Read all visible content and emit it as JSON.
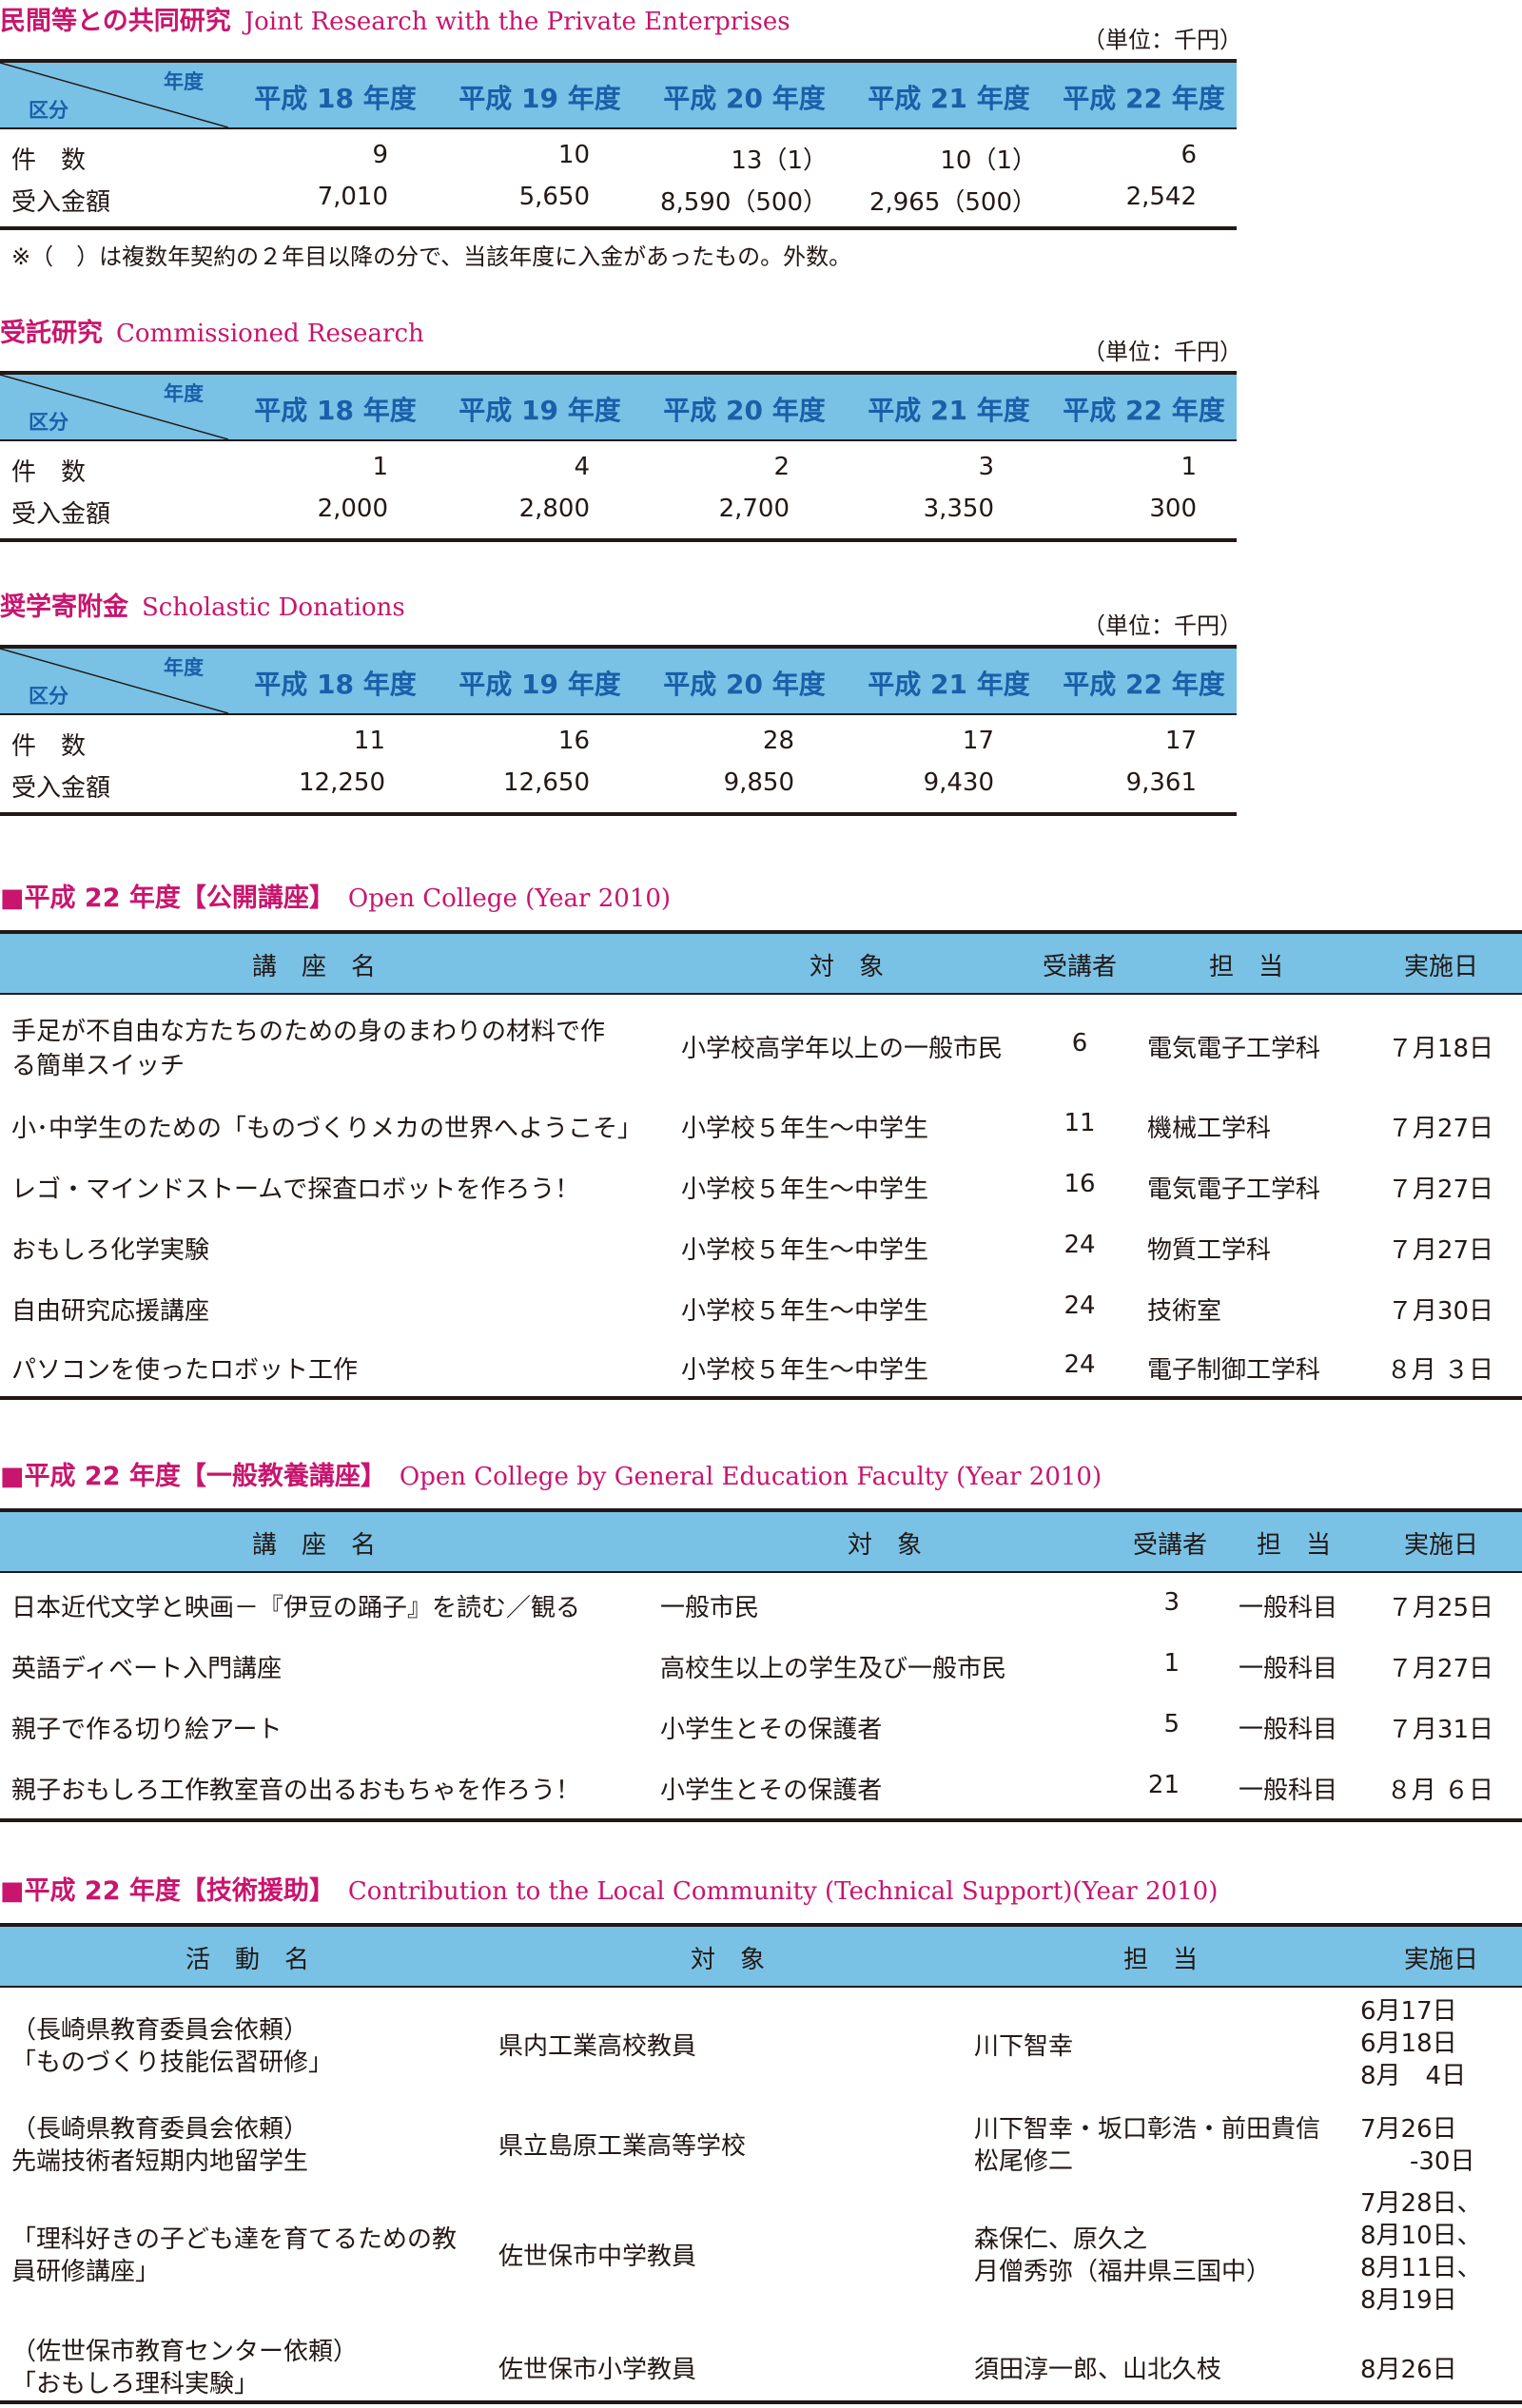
{
  "unit_label": "（単位：千円）",
  "years": [
    "平成 18 年度",
    "平成 19 年度",
    "平成 20 年度",
    "平成 21 年度",
    "平成 22 年度"
  ],
  "corner_year": "年度",
  "corner_category": "区分",
  "joint": {
    "title_ja": "民間等との共同研究",
    "title_en": "Joint Research with the Private Enterprises",
    "rows": [
      {
        "label": "件　数",
        "values": [
          "9",
          "10",
          "13（1）",
          "10（1）",
          "6"
        ]
      },
      {
        "label": "受入金額",
        "values": [
          "7,010",
          "5,650",
          "8,590（500）",
          "2,965（500）",
          "2,542"
        ]
      }
    ],
    "note": "※（　）は複数年契約の２年目以降の分で、当該年度に入金があったもの。外数。"
  },
  "commissioned": {
    "title_ja": "受託研究",
    "title_en": "Commissioned Research",
    "rows": [
      {
        "label": "件　数",
        "values": [
          "1",
          "4",
          "2",
          "3",
          "1"
        ]
      },
      {
        "label": "受入金額",
        "values": [
          "2,000",
          "2,800",
          "2,700",
          "3,350",
          "300"
        ]
      }
    ]
  },
  "donations": {
    "title_ja": "奨学寄附金",
    "title_en": "Scholastic Donations",
    "rows": [
      {
        "label": "件　数",
        "values": [
          "11",
          "16",
          "28",
          "17",
          "17"
        ]
      },
      {
        "label": "受入金額",
        "values": [
          "12,250",
          "12,650",
          "9,850",
          "9,430",
          "9,361"
        ]
      }
    ]
  },
  "open_college": {
    "title_ja": "■平成 22 年度【公開講座】",
    "title_en": "Open College (Year 2010)",
    "headers": [
      "講　座　名",
      "対　象",
      "受講者",
      "担　当",
      "実施日"
    ],
    "rows": [
      {
        "name": [
          "手足が不自由な方たちのための身のまわりの材料で作",
          "る簡単スイッチ"
        ],
        "target": "小学校高学年以上の一般市民",
        "count": "6",
        "dept": "電気電子工学科",
        "date": "７月18日"
      },
      {
        "name": [
          "小･中学生のための「ものづくりメカの世界へようこそ」"
        ],
        "target": "小学校５年生～中学生",
        "count": "11",
        "dept": "機械工学科",
        "date": "７月27日"
      },
      {
        "name": [
          "レゴ・マインドストームで探査ロボットを作ろう！"
        ],
        "target": "小学校５年生～中学生",
        "count": "16",
        "dept": "電気電子工学科",
        "date": "７月27日"
      },
      {
        "name": [
          "おもしろ化学実験"
        ],
        "target": "小学校５年生～中学生",
        "count": "24",
        "dept": "物質工学科",
        "date": "７月27日"
      },
      {
        "name": [
          "自由研究応援講座"
        ],
        "target": "小学校５年生～中学生",
        "count": "24",
        "dept": "技術室",
        "date": "７月30日"
      },
      {
        "name": [
          "パソコンを使ったロボット工作"
        ],
        "target": "小学校５年生～中学生",
        "count": "24",
        "dept": "電子制御工学科",
        "date": "８月 ３日"
      }
    ]
  },
  "general_ed": {
    "title_ja": "■平成 22 年度【一般教養講座】",
    "title_en": "Open College by General Education Faculty (Year 2010)",
    "headers": [
      "講　座　名",
      "対　象",
      "受講者",
      "担　当",
      "実施日"
    ],
    "rows": [
      {
        "name": "日本近代文学と映画－『伊豆の踊子』を読む／観る",
        "target": "一般市民",
        "count": "3",
        "dept": "一般科目",
        "date": "７月25日"
      },
      {
        "name": "英語ディベート入門講座",
        "target": "高校生以上の学生及び一般市民",
        "count": "1",
        "dept": "一般科目",
        "date": "７月27日"
      },
      {
        "name": "親子で作る切り絵アート",
        "target": "小学生とその保護者",
        "count": "5",
        "dept": "一般科目",
        "date": "７月31日"
      },
      {
        "name": "親子おもしろ工作教室音の出るおもちゃを作ろう！",
        "target": "小学生とその保護者",
        "count": "21",
        "dept": "一般科目",
        "date": "８月 ６日"
      }
    ]
  },
  "tech_support": {
    "title_ja": "■平成 22 年度【技術援助】",
    "title_en": "Contribution to the Local Community (Technical Support)(Year 2010)",
    "headers": [
      "活　動　名",
      "対　象",
      "担　当",
      "実施日"
    ],
    "rows": [
      {
        "name": [
          "（長崎県教育委員会依頼）",
          "「ものづくり技能伝習研修」"
        ],
        "target": "県内工業高校教員",
        "staff": [
          "川下智幸"
        ],
        "date": [
          "6月17日",
          "6月18日",
          "8月　4日"
        ]
      },
      {
        "name": [
          "（長崎県教育委員会依頼）",
          "先端技術者短期内地留学生"
        ],
        "target": "県立島原工業高等学校",
        "staff": [
          "川下智幸・坂口彰浩・前田貴信",
          "松尾修二"
        ],
        "date": [
          "7月26日",
          "　　-30日"
        ]
      },
      {
        "name": [
          "「理科好きの子ども達を育てるための教",
          "員研修講座」"
        ],
        "target": "佐世保市中学教員",
        "staff": [
          "森保仁、原久之",
          "月僧秀弥（福井県三国中）"
        ],
        "date": [
          "7月28日、",
          "8月10日、",
          "8月11日、",
          "8月19日"
        ]
      },
      {
        "name": [
          "（佐世保市教育センター依頼）",
          "「おもしろ理科実験」"
        ],
        "target": "佐世保市小学教員",
        "staff": [
          "須田淳一郎、山北久枝"
        ],
        "date": [
          "8月26日"
        ]
      }
    ]
  }
}
